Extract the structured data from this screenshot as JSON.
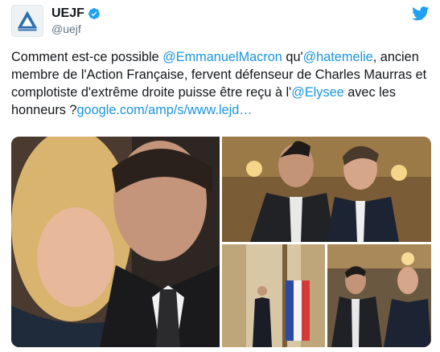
{
  "account": {
    "display_name": "UEJF",
    "handle": "@uejf",
    "verified": true,
    "avatar_icon": "uejf-logo-icon",
    "brand_icon": "twitter-bird-icon",
    "brand_color": "#1da1f2"
  },
  "tweet": {
    "segments": [
      {
        "type": "text",
        "value": "Comment est-ce possible "
      },
      {
        "type": "link",
        "value": "@EmmanuelMacron"
      },
      {
        "type": "text",
        "value": " qu'"
      },
      {
        "type": "link",
        "value": "@hatemelie"
      },
      {
        "type": "text",
        "value": ", ancien membre de l'Action Française, fervent défenseur de Charles Maurras et complotiste d'extrême droite puisse être  reçu à l'"
      },
      {
        "type": "link",
        "value": "@Elysee"
      },
      {
        "type": "text",
        "value": " avec les honneurs ?"
      },
      {
        "type": "link",
        "value": "google.com/amp/s/www.lejd…"
      }
    ],
    "link_color": "#1b95e0"
  },
  "media": {
    "photos": [
      {
        "name": "photo-selfie"
      },
      {
        "name": "photo-handshake-hall"
      },
      {
        "name": "photo-standing-flags"
      },
      {
        "name": "photo-two-men-hall"
      }
    ]
  }
}
